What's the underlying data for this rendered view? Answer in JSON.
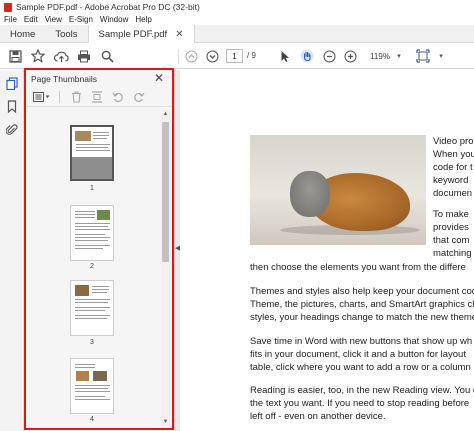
{
  "window": {
    "title": "Sample PDF.pdf - Adobe Acrobat Pro DC (32-bit)"
  },
  "menu": [
    "File",
    "Edit",
    "View",
    "E-Sign",
    "Window",
    "Help"
  ],
  "tabs": {
    "home": "Home",
    "tools": "Tools",
    "doc": "Sample PDF.pdf"
  },
  "toolbar": {
    "page_current": "1",
    "page_total": "/ 9",
    "zoom": "119%",
    "icons": [
      "save-icon",
      "bookmark-star-icon",
      "upload-icon",
      "print-icon",
      "search-icon",
      "page-up-icon",
      "page-down-icon",
      "select-cursor-icon",
      "hand-icon",
      "zoom-out-icon",
      "zoom-in-icon",
      "zoom-dropdown-icon",
      "fit-page-icon"
    ]
  },
  "panel": {
    "title": "Page Thumbnails",
    "tools": [
      "options-menu-icon",
      "delete-icon",
      "insert-page-icon",
      "undo-icon",
      "redo-icon"
    ],
    "thumbnails": [
      {
        "label": "1",
        "selected": true
      },
      {
        "label": "2",
        "selected": false
      },
      {
        "label": "3",
        "selected": false
      },
      {
        "label": "4",
        "selected": false
      }
    ]
  },
  "document": {
    "right_col": [
      "Video pro",
      "When you",
      "code for t",
      "keyword",
      "documen",
      "To make",
      "provides",
      "that com",
      "matching"
    ],
    "paragraphs": [
      "then choose the elements you want from the differe",
      "Themes and styles also help keep your document coc",
      "Theme, the pictures, charts, and SmartArt graphics ch",
      "styles, your headings change to match the new theme",
      "Save time in Word with new buttons that show up wh",
      "fits in your document, click it and a button for layout",
      "table, click where you want to add a row or a column",
      "Reading is easier, too, in the new Reading view. You c",
      "the text you want. If you need to stop reading before",
      "left off - even on another device."
    ]
  }
}
